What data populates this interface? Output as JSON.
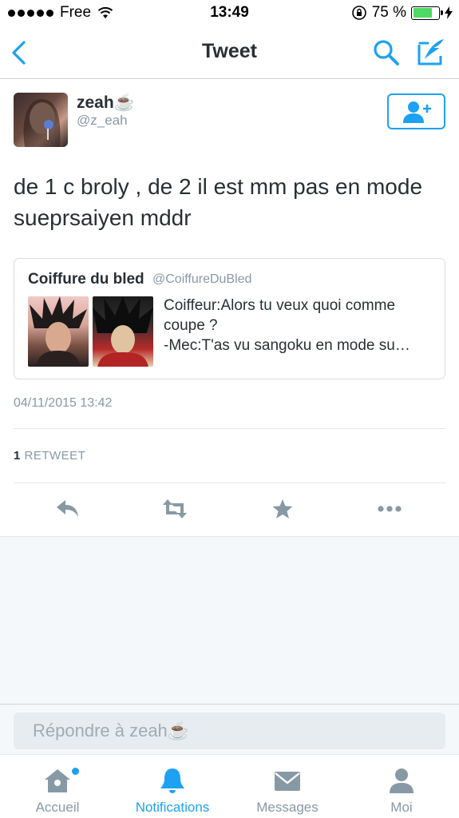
{
  "status_bar": {
    "carrier": "Free",
    "time": "13:49",
    "battery_text": "75 %",
    "battery_level": 0.75
  },
  "nav": {
    "title": "Tweet"
  },
  "tweet": {
    "display_name": "zeah☕️",
    "handle": "@z_eah",
    "text": "de 1 c broly , de 2 il est mm pas en mode sueprsaiyen mddr",
    "timestamp": "04/11/2015 13:42",
    "retweet_count": "1",
    "retweet_label": "RETWEET"
  },
  "quote": {
    "name": "Coiffure du bled",
    "handle": "@CoiffureDuBled",
    "lines": [
      "Coiffeur:Alors tu veux quoi comme",
      "coupe ?",
      "-Mec:T'as vu sangoku en mode su…"
    ]
  },
  "reply": {
    "placeholder": "Répondre à zeah☕️"
  },
  "tabs": [
    {
      "label": "Accueil",
      "icon": "home-icon"
    },
    {
      "label": "Notifications",
      "icon": "bell-icon"
    },
    {
      "label": "Messages",
      "icon": "envelope-icon"
    },
    {
      "label": "Moi",
      "icon": "person-icon"
    }
  ],
  "colors": {
    "accent": "#1da1f2",
    "muted": "#8899a6",
    "text": "#292f33"
  }
}
